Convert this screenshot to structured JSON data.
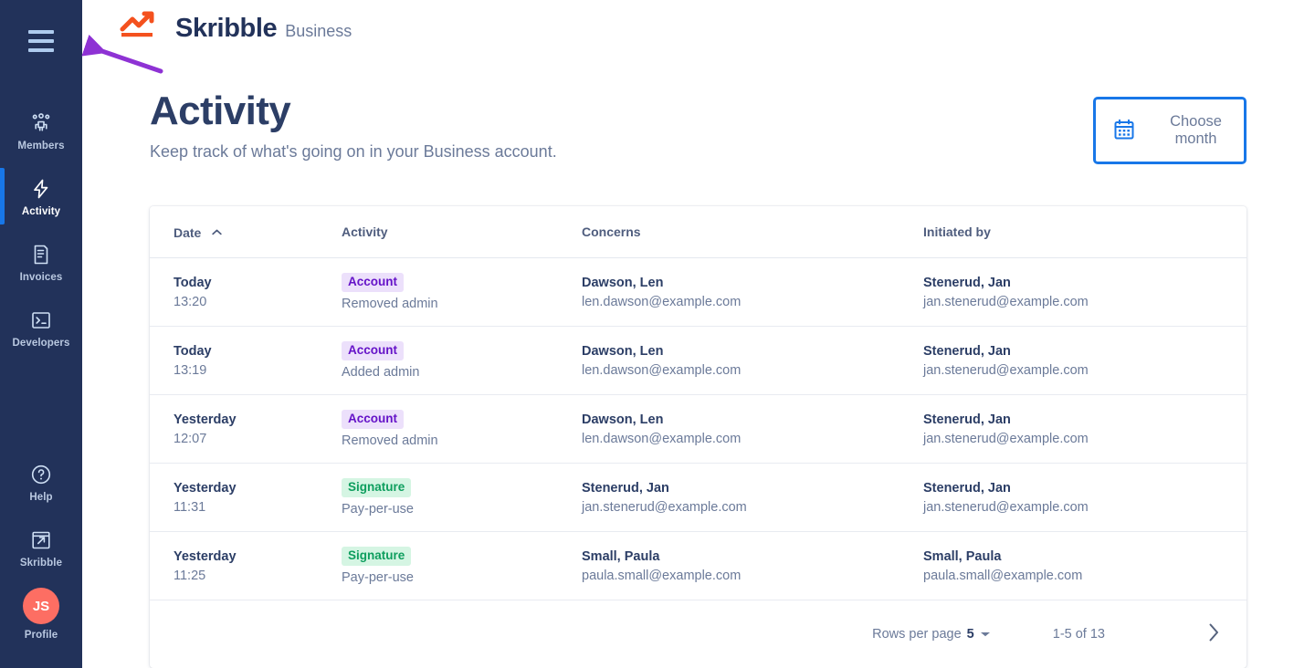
{
  "brand": {
    "logo_icon": "skribble-chart-logo-icon",
    "name": "Skribble",
    "suffix": "Business",
    "accent_orange": "#f4511e",
    "navy": "#22325a"
  },
  "sidebar": {
    "menu_icon": "hamburger-menu-icon",
    "bg_color": "#22325a",
    "active_indicator_color": "#1877e8",
    "items": [
      {
        "label": "Members",
        "icon": "members-icon",
        "active": false
      },
      {
        "label": "Activity",
        "icon": "activity-bolt-icon",
        "active": true
      },
      {
        "label": "Invoices",
        "icon": "invoice-document-icon",
        "active": false
      },
      {
        "label": "Developers",
        "icon": "developers-terminal-icon",
        "active": false
      }
    ],
    "bottom_items": [
      {
        "label": "Help",
        "icon": "help-question-icon"
      },
      {
        "label": "Skribble",
        "icon": "external-link-icon"
      }
    ],
    "profile": {
      "label": "Profile",
      "initials": "JS",
      "avatar_color": "#fd6e63"
    }
  },
  "page": {
    "title": "Activity",
    "subtitle": "Keep track of what's going on in your Business account."
  },
  "choose_month": {
    "label": "Choose month",
    "icon": "calendar-icon",
    "border_color": "#1877e8"
  },
  "table": {
    "columns": [
      {
        "key": "date",
        "label": "Date",
        "sort": "asc",
        "sort_icon": "chevron-up-icon"
      },
      {
        "key": "activity",
        "label": "Activity"
      },
      {
        "key": "concerns",
        "label": "Concerns"
      },
      {
        "key": "initiated",
        "label": "Initiated by"
      }
    ],
    "rows": [
      {
        "date": "Today",
        "time": "13:20",
        "badge": "Account",
        "badge_type": "account",
        "activity": "Removed admin",
        "concerns_name": "Dawson, Len",
        "concerns_email": "len.dawson@example.com",
        "initiated_name": "Stenerud, Jan",
        "initiated_email": "jan.stenerud@example.com"
      },
      {
        "date": "Today",
        "time": "13:19",
        "badge": "Account",
        "badge_type": "account",
        "activity": "Added admin",
        "concerns_name": "Dawson, Len",
        "concerns_email": "len.dawson@example.com",
        "initiated_name": "Stenerud, Jan",
        "initiated_email": "jan.stenerud@example.com"
      },
      {
        "date": "Yesterday",
        "time": "12:07",
        "badge": "Account",
        "badge_type": "account",
        "activity": "Removed admin",
        "concerns_name": "Dawson, Len",
        "concerns_email": "len.dawson@example.com",
        "initiated_name": "Stenerud, Jan",
        "initiated_email": "jan.stenerud@example.com"
      },
      {
        "date": "Yesterday",
        "time": "11:31",
        "badge": "Signature",
        "badge_type": "signature",
        "activity": "Pay-per-use",
        "concerns_name": "Stenerud, Jan",
        "concerns_email": "jan.stenerud@example.com",
        "initiated_name": "Stenerud, Jan",
        "initiated_email": "jan.stenerud@example.com"
      },
      {
        "date": "Yesterday",
        "time": "11:25",
        "badge": "Signature",
        "badge_type": "signature",
        "activity": "Pay-per-use",
        "concerns_name": "Small, Paula",
        "concerns_email": "paula.small@example.com",
        "initiated_name": "Small, Paula",
        "initiated_email": "paula.small@example.com"
      }
    ]
  },
  "pagination": {
    "rows_per_page_label": "Rows per page",
    "rows_per_page_value": "5",
    "dropdown_icon": "caret-down-icon",
    "range": "1-5 of 13",
    "next_icon": "chevron-right-icon"
  },
  "annotation": {
    "type": "arrow",
    "color": "#8e32d4",
    "points_at": "hamburger-menu-icon"
  }
}
